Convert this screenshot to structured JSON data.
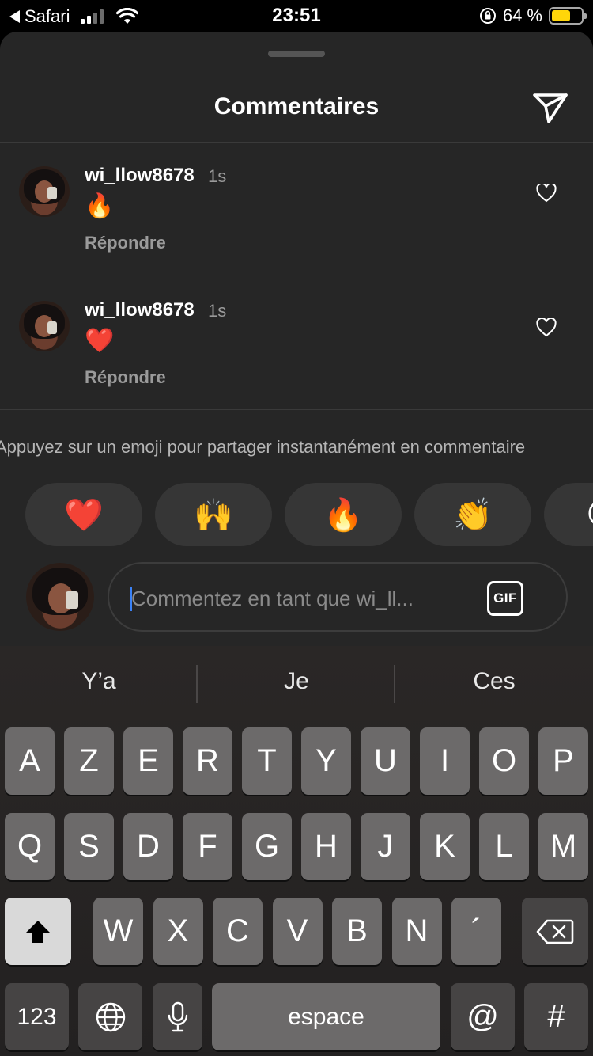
{
  "status_bar": {
    "back_app": "Safari",
    "time": "23:51",
    "battery_percent": "64 %",
    "battery_level": 0.64,
    "battery_color": "#ffd60a"
  },
  "sheet": {
    "title": "Commentaires",
    "share_icon": "send-icon"
  },
  "comments": [
    {
      "username": "wi_llow8678",
      "time": "1s",
      "emoji": "🔥",
      "reply_label": "Répondre",
      "like_icon": "heart-outline-icon"
    },
    {
      "username": "wi_llow8678",
      "time": "1s",
      "emoji": "❤️",
      "reply_label": "Répondre",
      "like_icon": "heart-outline-icon"
    }
  ],
  "quick_reactions": {
    "hint": "Appuyez sur un emoji pour partager instantanément en commentaire",
    "emojis": [
      "❤️",
      "🙌",
      "🔥",
      "👏",
      "😢"
    ]
  },
  "composer": {
    "placeholder": "Commentez en tant que wi_ll...",
    "gif_label": "GIF"
  },
  "keyboard": {
    "suggestions": [
      "Y’a",
      "Je",
      "Ces"
    ],
    "row1": [
      "A",
      "Z",
      "E",
      "R",
      "T",
      "Y",
      "U",
      "I",
      "O",
      "P"
    ],
    "row2": [
      "Q",
      "S",
      "D",
      "F",
      "G",
      "H",
      "J",
      "K",
      "L",
      "M"
    ],
    "row3": [
      "W",
      "X",
      "C",
      "V",
      "B",
      "N",
      "´"
    ],
    "numbers_label": "123",
    "space_label": "espace",
    "at_label": "@",
    "hash_label": "#"
  },
  "colors": {
    "sheet_bg": "#262626",
    "accent_caret": "#3b82f6"
  }
}
